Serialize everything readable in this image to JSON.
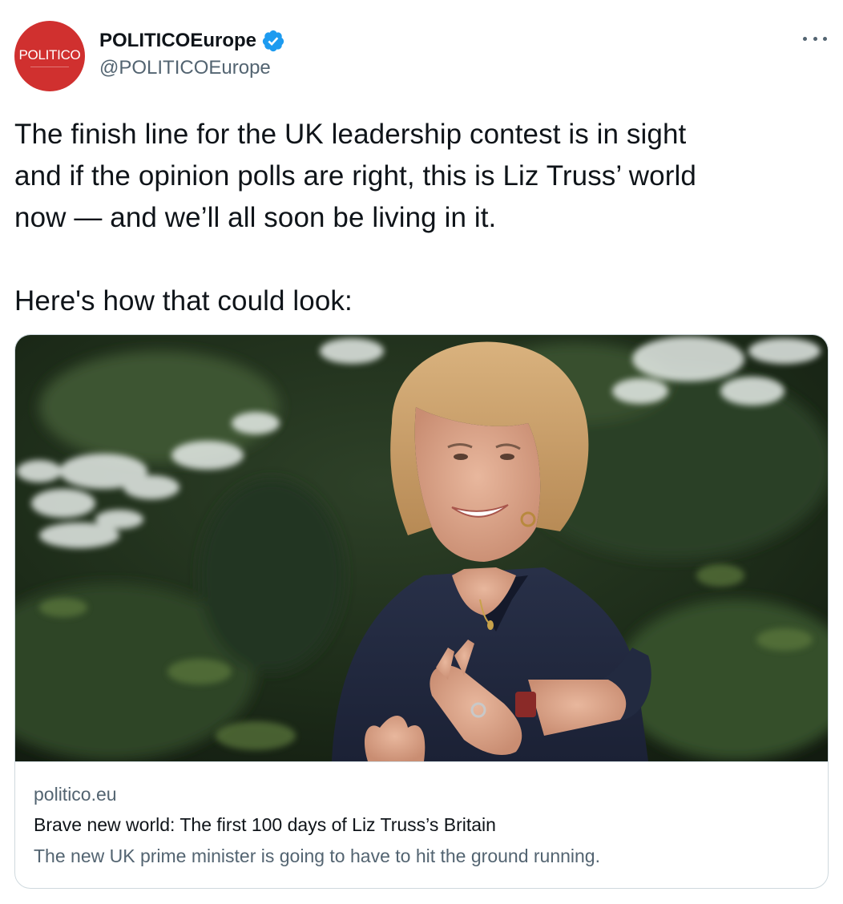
{
  "author": {
    "avatar_logo_text": "POLITICO",
    "display_name": "POLITICOEurope",
    "handle": "@POLITICOEurope",
    "verified_icon": "verified-badge-icon",
    "avatar_color": "#d0302f",
    "verified_color": "#1d9bf0"
  },
  "actions": {
    "more_icon": "more-horizontal-icon"
  },
  "tweet": {
    "line1": "The finish line for the UK leadership contest is in sight",
    "line2": "and if the opinion polls are right, this is Liz Truss’ world",
    "line3": "now — and we’ll all soon be living in it.",
    "line4": "Here's how that could look:"
  },
  "card": {
    "domain": "politico.eu",
    "title": "Brave new world: The first 100 days of Liz Truss’s Britain",
    "description": "The new UK prime minister is going to have to hit the ground running."
  }
}
